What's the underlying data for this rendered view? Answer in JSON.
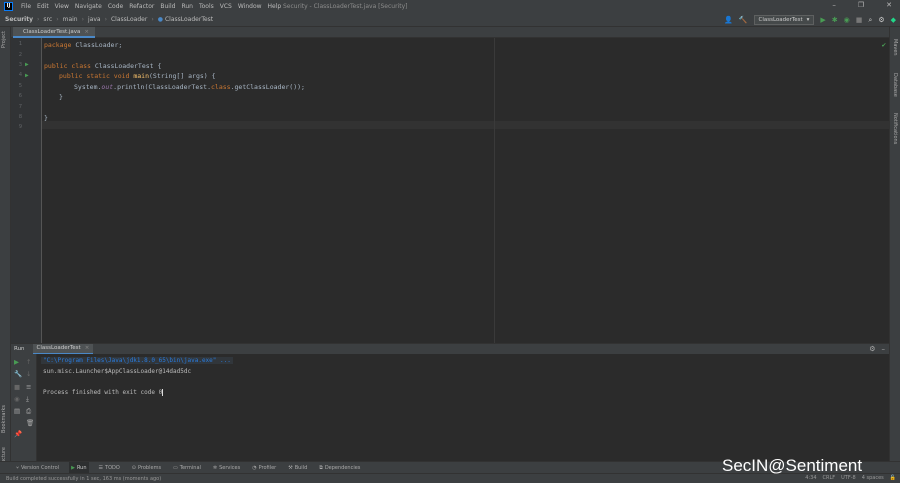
{
  "titlebar": {
    "menu": [
      "File",
      "Edit",
      "View",
      "Navigate",
      "Code",
      "Refactor",
      "Build",
      "Run",
      "Tools",
      "VCS",
      "Window",
      "Help"
    ],
    "window_title": "Security - ClassLoaderTest.java [Security]"
  },
  "navbar": {
    "breadcrumbs": [
      "Security",
      "src",
      "main",
      "java",
      "ClassLoader",
      "ClassLoaderTest"
    ],
    "run_config": "ClassLoaderTest"
  },
  "left_strip": {
    "project": "Project",
    "bookmarks": "Bookmarks",
    "structure": "Structure"
  },
  "right_strip": {
    "maven": "Maven",
    "database": "Database",
    "notifications": "Notifications"
  },
  "editor": {
    "tab": "ClassLoaderTest.java",
    "line_numbers": [
      "1",
      "2",
      "3",
      "4",
      "5",
      "6",
      "7",
      "8",
      "9"
    ],
    "code": {
      "l1_kw": "package ",
      "l1_rest": "ClassLoader;",
      "l3_kw": "public class ",
      "l3_rest": "ClassLoaderTest {",
      "l4_kw": "public static void ",
      "l4_fn": "main",
      "l4_rest": "(String[] args) {",
      "l5_a": "System.",
      "l5_field": "out",
      "l5_b": ".println(ClassLoaderTest.",
      "l5_kw": "class",
      "l5_c": ".getClassLoader());",
      "l6": "}",
      "l8": "}"
    }
  },
  "run_panel": {
    "label": "Run",
    "tab": "ClassLoaderTest",
    "console": {
      "cmd": "\"C:\\Program Files\\Java\\jdk1.8.0_65\\bin\\java.exe\" ...",
      "output": "sun.misc.Launcher$AppClassLoader@14dad5dc",
      "exit": "Process finished with exit code 0"
    }
  },
  "bottom_tools": [
    "Version Control",
    "Run",
    "TODO",
    "Problems",
    "Terminal",
    "Services",
    "Profiler",
    "Build",
    "Dependencies"
  ],
  "statusbar": {
    "message": "Build completed successfully in 1 sec, 163 ms (moments ago)",
    "position": "4:34",
    "line_sep": "CRLF",
    "encoding": "UTF-8",
    "indent": "4 spaces"
  },
  "watermark": "SecIN@Sentiment",
  "colors": {
    "accent": "#4a88c7",
    "run_green": "#499c54",
    "keyword": "#cc7832",
    "function": "#ffc66d",
    "field": "#9876aa",
    "link": "#287bde"
  }
}
